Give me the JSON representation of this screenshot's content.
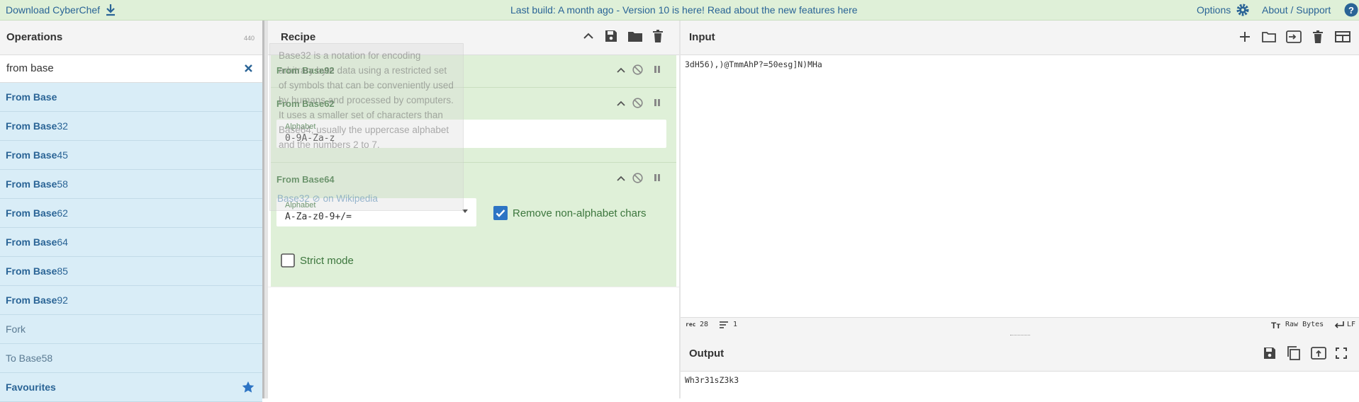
{
  "banner": {
    "download_label": "Download CyberChef",
    "notice": "Last build: A month ago - Version 10 is here! Read about the new features here",
    "options_label": "Options",
    "about_label": "About / Support"
  },
  "operations": {
    "title": "Operations",
    "count": "440",
    "search_value": "from base",
    "items": [
      {
        "bold": "From Base",
        "rest": ""
      },
      {
        "bold": "From Base",
        "rest": "32"
      },
      {
        "bold": "From Base",
        "rest": "45"
      },
      {
        "bold": "From Base",
        "rest": "58"
      },
      {
        "bold": "From Base",
        "rest": "62"
      },
      {
        "bold": "From Base",
        "rest": "64"
      },
      {
        "bold": "From Base",
        "rest": "85"
      },
      {
        "bold": "From Base",
        "rest": "92"
      }
    ],
    "fork_label": "Fork",
    "tobase58_label": "To Base58",
    "favourites_label": "Favourites"
  },
  "recipe": {
    "title": "Recipe",
    "ops": [
      {
        "title": "From Base92"
      },
      {
        "title": "From Base62",
        "alphabet_label": "Alphabet",
        "alphabet_value": "0-9A-Za-z"
      },
      {
        "title": "From Base64",
        "alphabet_label": "Alphabet",
        "alphabet_value": "A-Za-z0-9+/=",
        "remove_label": "Remove non-alphabet chars",
        "strict_label": "Strict mode"
      }
    ],
    "tooltip": "Base32 is a notation for encoding arbitrary byte data using a restricted set of symbols that can be conveniently used by humans and processed by computers. It uses a smaller set of characters than Base64, usually the uppercase alphabet and the numbers 2 to 7.",
    "tooltip_link": "Base32 ⊘ on Wikipedia"
  },
  "input": {
    "title": "Input",
    "value": "3dH56),)@TmmAhP?=50esg]N)MHa",
    "status": {
      "length_icon": "rec",
      "length": "28",
      "lines": "1",
      "encoding": "Raw Bytes",
      "eol": "LF"
    }
  },
  "output": {
    "title": "Output",
    "value": "Wh3r31sZ3k3"
  },
  "colors": {
    "banner_bg": "#dff0d8",
    "op_item_bg": "#d9edf7",
    "link": "#2a6496",
    "recipe_green": "#3c763d",
    "checkbox_blue": "#2d74c4"
  }
}
